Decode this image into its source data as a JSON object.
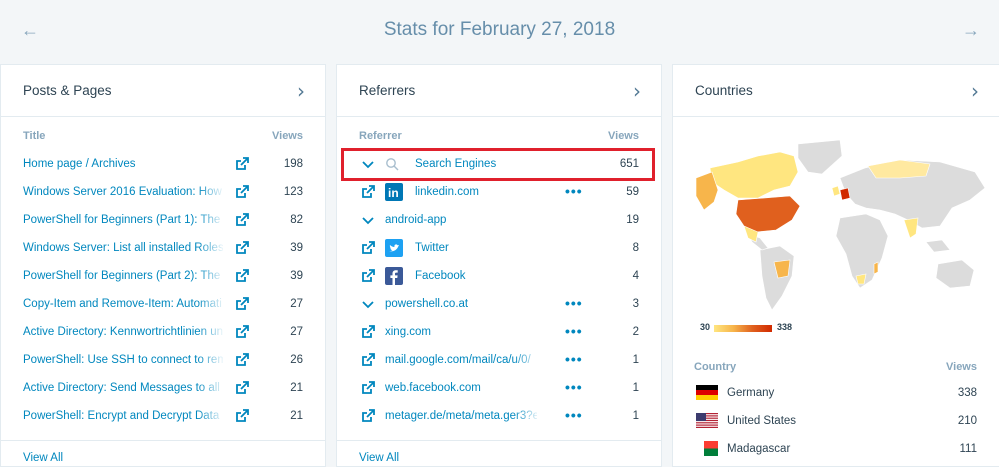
{
  "header": {
    "title": "Stats for February 27, 2018",
    "prev_icon": "arrow-left-icon",
    "next_icon": "arrow-right-icon"
  },
  "posts": {
    "title": "Posts & Pages",
    "col_title": "Title",
    "col_views": "Views",
    "rows": [
      {
        "label": "Home page / Archives",
        "views": "198"
      },
      {
        "label": "Windows Server 2016 Evaluation: How t",
        "views": "123"
      },
      {
        "label": "PowerShell for Beginners (Part 1): The C",
        "views": "82"
      },
      {
        "label": "Windows Server: List all installed Roles a",
        "views": "39"
      },
      {
        "label": "PowerShell for Beginners (Part 2): The Pi",
        "views": "39"
      },
      {
        "label": "Copy-Item and Remove-Item: Automati",
        "views": "27"
      },
      {
        "label": "Active Directory: Kennwortrichtlinien un",
        "views": "27"
      },
      {
        "label": "PowerShell: Use SSH to connect to remo",
        "views": "26"
      },
      {
        "label": "Active Directory: Send Messages to all c",
        "views": "21"
      },
      {
        "label": "PowerShell: Encrypt and Decrypt Data b",
        "views": "21"
      }
    ],
    "view_all": "View All"
  },
  "referrers": {
    "title": "Referrers",
    "col_title": "Referrer",
    "col_views": "Views",
    "rows": [
      {
        "label": "Search Engines",
        "views": "651",
        "icon": "search-icon",
        "lead": "chevron-down-icon",
        "dots": false
      },
      {
        "label": "linkedin.com",
        "views": "59",
        "icon": "linkedin-icon",
        "lead": "external-link-icon",
        "dots": true
      },
      {
        "label": "android-app",
        "views": "19",
        "icon": "",
        "lead": "chevron-down-icon",
        "dots": false
      },
      {
        "label": "Twitter",
        "views": "8",
        "icon": "twitter-icon",
        "lead": "external-link-icon",
        "dots": false
      },
      {
        "label": "Facebook",
        "views": "4",
        "icon": "facebook-icon",
        "lead": "external-link-icon",
        "dots": false
      },
      {
        "label": "powershell.co.at",
        "views": "3",
        "icon": "",
        "lead": "chevron-down-icon",
        "dots": true
      },
      {
        "label": "xing.com",
        "views": "2",
        "icon": "",
        "lead": "external-link-icon",
        "dots": true
      },
      {
        "label": "mail.google.com/mail/ca/u/0/",
        "views": "1",
        "icon": "",
        "lead": "external-link-icon",
        "dots": true
      },
      {
        "label": "web.facebook.com",
        "views": "1",
        "icon": "",
        "lead": "external-link-icon",
        "dots": true
      },
      {
        "label": "metager.de/meta/meta.ger3?e",
        "views": "1",
        "icon": "",
        "lead": "external-link-icon",
        "dots": true
      }
    ],
    "more_label": "•••",
    "view_all": "View All"
  },
  "countries": {
    "title": "Countries",
    "legend_min": "30",
    "legend_max": "338",
    "col_title": "Country",
    "col_views": "Views",
    "rows": [
      {
        "label": "Germany",
        "views": "338",
        "flag": "germany-flag"
      },
      {
        "label": "United States",
        "views": "210",
        "flag": "us-flag"
      },
      {
        "label": "Madagascar",
        "views": "111",
        "flag": "madagascar-flag"
      }
    ]
  },
  "colors": {
    "accent": "#0087be",
    "highlight": "#e0202c",
    "map_high": "#d12a00",
    "map_low": "#ffe680"
  }
}
